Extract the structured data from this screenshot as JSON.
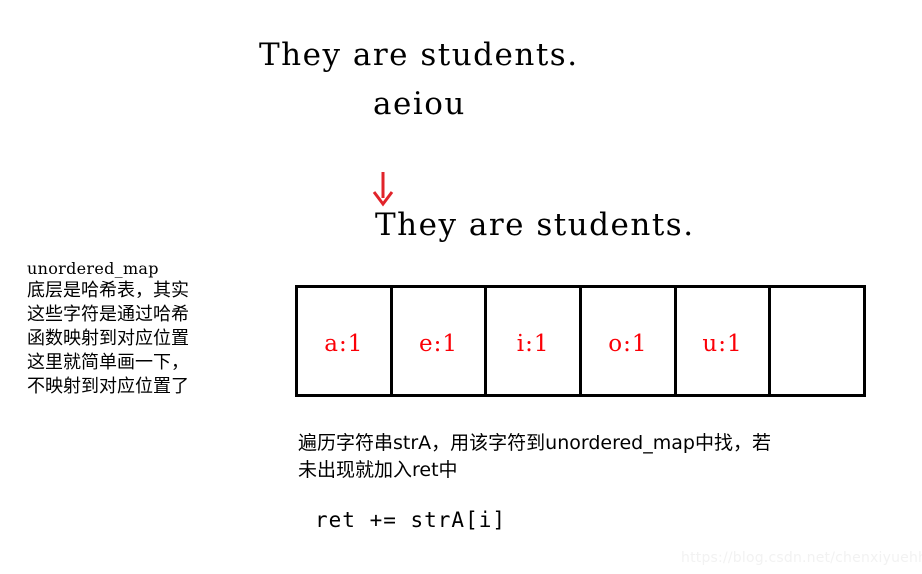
{
  "colors": {
    "background": "#ffffff",
    "text": "#000000",
    "accent_red": "#fb0007",
    "border": "#000000",
    "watermark": "#f2f2f2"
  },
  "top": {
    "input_string_label": "They are students.",
    "vowel_string_label": "aeiou",
    "arrow_icon": "arrow-down-icon",
    "result_string_label": "They are students."
  },
  "note": {
    "title": "unordered_map",
    "lines": [
      "底层是哈希表，其实",
      "这些字符是通过哈希",
      "函数映射到对应位置",
      "这里就简单画一下，",
      "不映射到对应位置了"
    ]
  },
  "hash_table": {
    "cells": [
      {
        "label": "a:1"
      },
      {
        "label": "e:1"
      },
      {
        "label": "i:1"
      },
      {
        "label": "o:1"
      },
      {
        "label": "u:1"
      },
      {
        "label": ""
      }
    ]
  },
  "description": {
    "lines": [
      "遍历字符串strA，用该字符到unordered_map中找，若",
      "未出现就加入ret中"
    ]
  },
  "code": {
    "statement": "ret += strA[i]"
  },
  "watermark": {
    "text": "https://blog.csdn.net/chenxiyuehh"
  }
}
